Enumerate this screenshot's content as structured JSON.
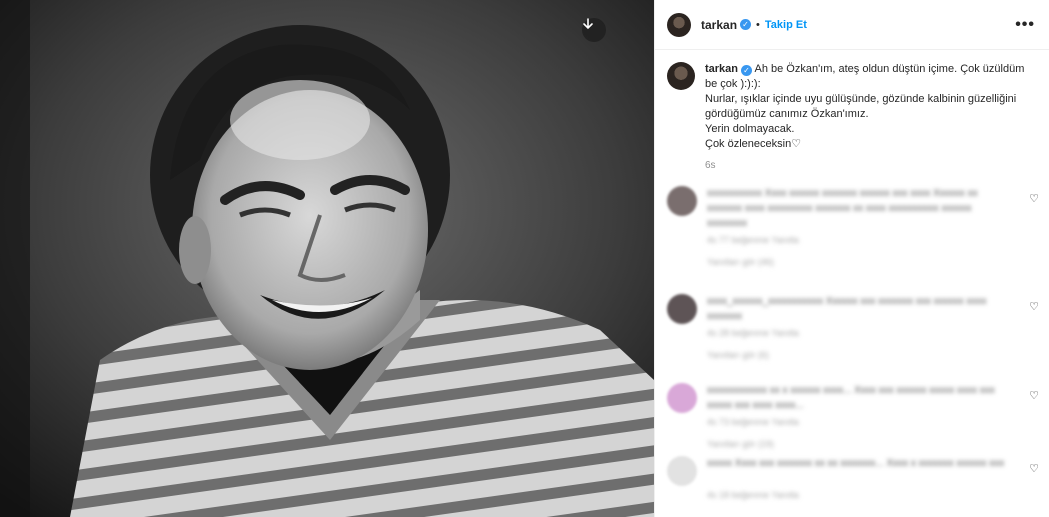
{
  "post": {
    "username": "tarkan",
    "verified_mark": "✓",
    "dot": "•",
    "follow_label": "Takip Et",
    "more_label": "•••",
    "download_icon": "download-icon",
    "caption": {
      "line1": " Ah be Özkan'ım, ateş oldun düştün içime. Çok üzüldüm be çok ):):):",
      "line2": "Nurlar, ışıklar içinde uyu gülüşünde, gözünde kalbinin güzelliğini gördüğümüz canımız Özkan'ımız.",
      "line3": "Yerin dolmayacak.",
      "line4": "Çok özleneceksin♡",
      "time": "6s"
    }
  },
  "comments": [
    {
      "text": "xxxxxxxxxxx Xxxx xxxxxx xxxxxxx xxxxxx xxx xxxx Xxxxxx xx xxxxxxx xxxx xxxxxxxxx xxxxxxx xx xxxx xxxxxxxxxx xxxxxx xxxxxxxx",
      "meta": "4s  77 beğenme  Yanıtla",
      "replies": "Yanıtları gör (46)",
      "heart": "♡",
      "color": "#7a6e6e"
    },
    {
      "text": "xxxx_xxxxxx_xxxxxxxxxxx Xxxxxx xxx xxxxxxx xxx xxxxxx xxxx xxxxxxx",
      "meta": "4s  28 beğenme  Yanıtla",
      "replies": "Yanıtları gör (6)",
      "heart": "♡",
      "color": "#5e5456"
    },
    {
      "text": "xxxxxxxxxxxx xx x xxxxxx xxxx... Xxxx xxx xxxxxx xxxxx xxxx xxx xxxxx xxx xxxx xxxx...",
      "meta": "4s  73 beğenme  Yanıtla",
      "replies": "Yanıtları gör (19)",
      "heart": "♡",
      "color": "#d9a8d8"
    },
    {
      "text": "xxxxx Xxxx xxx xxxxxxx xx xx xxxxxxx... Xxxx x xxxxxxx xxxxxx xxx",
      "meta": "4s  18 beğenme  Yanıtla",
      "replies": "",
      "heart": "♡",
      "color": "#e2e2e2"
    }
  ]
}
